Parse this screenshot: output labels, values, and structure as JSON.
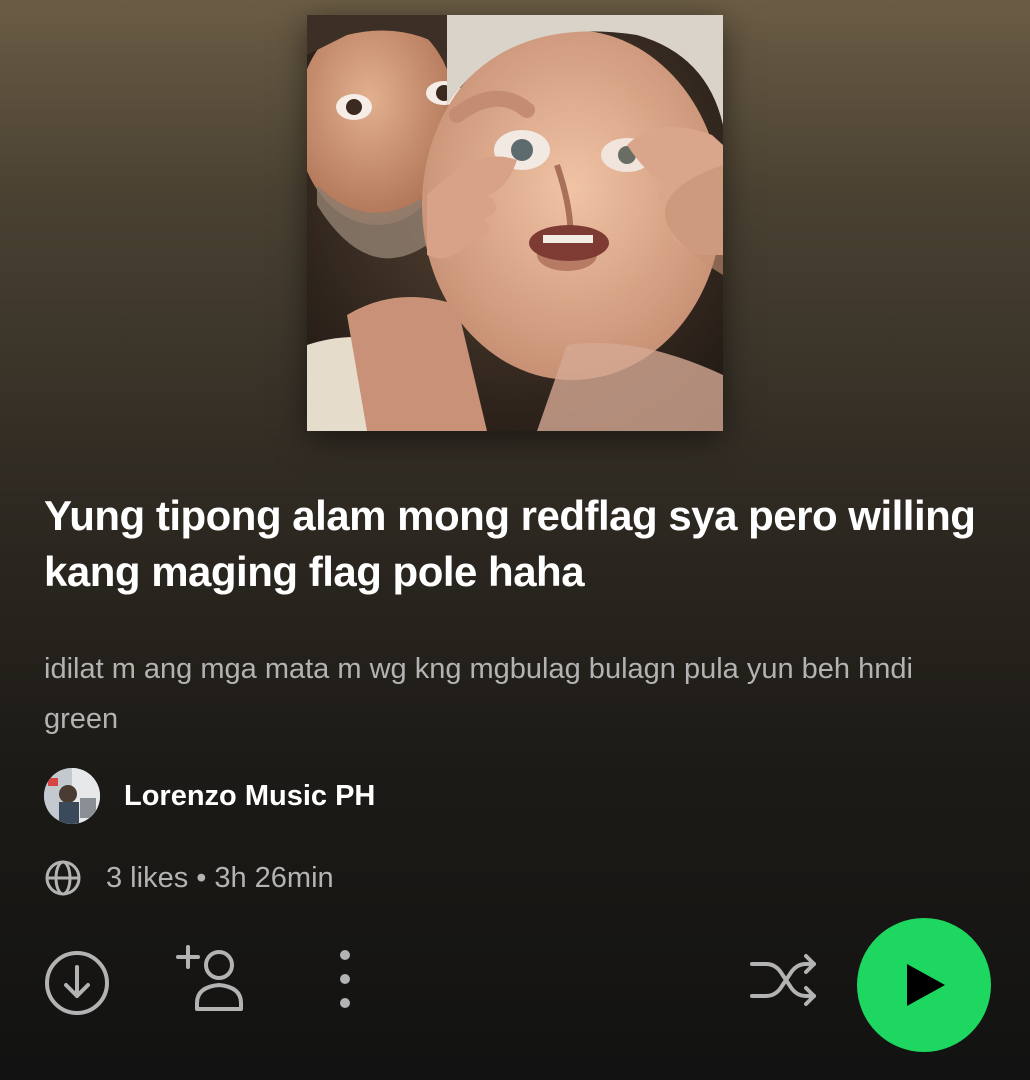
{
  "playlist": {
    "title": "Yung tipong alam mong redflag sya pero willing kang maging flag pole haha",
    "description": "idilat m ang mga mata m wg kng mgbulag bulagn pula yun beh hndi green",
    "owner": "Lorenzo Music PH",
    "likes": "3 likes",
    "separator": "•",
    "duration": "3h 26min"
  },
  "icons": {
    "globe": "globe-icon",
    "download": "download-icon",
    "add_user": "add-user-icon",
    "more": "more-vertical-icon",
    "shuffle": "shuffle-icon",
    "play": "play-icon"
  },
  "colors": {
    "accent": "#1ed760",
    "text_primary": "#ffffff",
    "text_secondary": "#b3b3b3",
    "background_top": "#6b5d45",
    "background_bottom": "#121212"
  }
}
